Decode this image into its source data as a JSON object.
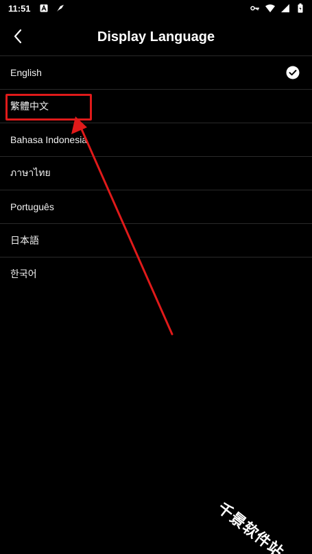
{
  "status_bar": {
    "time": "11:51",
    "left_icons": [
      "app-a-icon",
      "feather-icon"
    ],
    "right_icons": [
      "vpn-key-icon",
      "wifi-icon",
      "cellular-icon",
      "battery-icon"
    ]
  },
  "header": {
    "title": "Display Language",
    "back_icon": "chevron-left-icon"
  },
  "languages": [
    {
      "label": "English",
      "selected": true
    },
    {
      "label": "繁體中文",
      "selected": false
    },
    {
      "label": "Bahasa Indonesia",
      "selected": false
    },
    {
      "label": "ภาษาไทย",
      "selected": false
    },
    {
      "label": "Português",
      "selected": false
    },
    {
      "label": "日本語",
      "selected": false
    },
    {
      "label": "한국어",
      "selected": false
    }
  ],
  "annotation": {
    "highlight_color": "#e01a1a",
    "watermark": "千景软件站"
  },
  "colors": {
    "background": "#000000",
    "text": "#ffffff",
    "divider": "#2a2a2a",
    "accent": "#e01a1a"
  }
}
